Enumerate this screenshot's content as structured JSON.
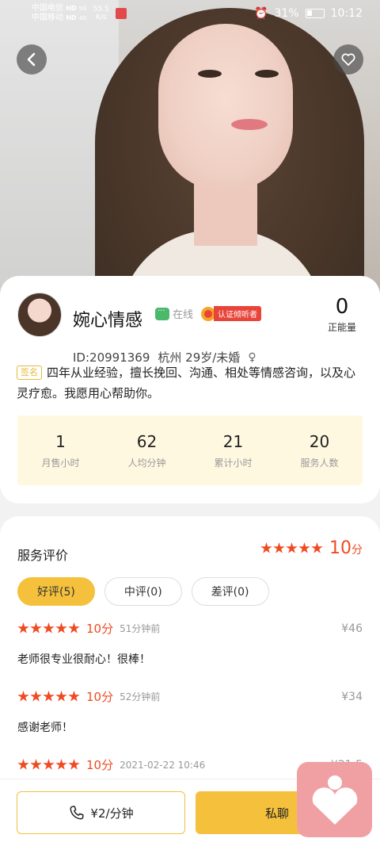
{
  "status_bar": {
    "carrier1": "中国电信",
    "carrier2": "中国移动",
    "net1": "HD",
    "net2": "HD",
    "signal1": "5G",
    "signal2": "4G",
    "speed_value": "55.5",
    "speed_unit": "K/s",
    "battery": "31%",
    "time": "10:12"
  },
  "profile": {
    "name": "婉心情感",
    "online_label": "在线",
    "cert_label": "认证倾听者",
    "energy_value": "0",
    "energy_label": "正能量",
    "id_text": "ID:20991369",
    "location_age": "杭州 29岁/未婚",
    "gender_symbol": "♀",
    "bio_tag": "签名",
    "bio": "四年从业经验，擅长挽回、沟通、相处等情感咨询，以及心灵疗愈。我愿用心帮助你。"
  },
  "stats": [
    {
      "value": "1",
      "label": "月售小时"
    },
    {
      "value": "62",
      "label": "人均分钟"
    },
    {
      "value": "21",
      "label": "累计小时"
    },
    {
      "value": "20",
      "label": "服务人数"
    }
  ],
  "reviews": {
    "title": "服务评价",
    "overall_score": "10",
    "score_unit": "分",
    "filters": [
      {
        "label": "好评(5)",
        "active": true
      },
      {
        "label": "中评(0)",
        "active": false
      },
      {
        "label": "差评(0)",
        "active": false
      }
    ],
    "items": [
      {
        "score": "10分",
        "time": "51分钟前",
        "price": "¥46",
        "text": "老师很专业很耐心！很棒！"
      },
      {
        "score": "10分",
        "time": "52分钟前",
        "price": "¥34",
        "text": "感谢老师！"
      },
      {
        "score": "10分",
        "time": "2021-02-22 10:46",
        "price": "¥21.5",
        "text": ""
      }
    ]
  },
  "actions": {
    "call_label": "¥2/分钟",
    "chat_label": "私聊"
  },
  "colors": {
    "accent_yellow": "#f5c13c",
    "star_red": "#f04a22",
    "online_green": "#4cb86a",
    "float_pink": "#f0a0a2"
  }
}
